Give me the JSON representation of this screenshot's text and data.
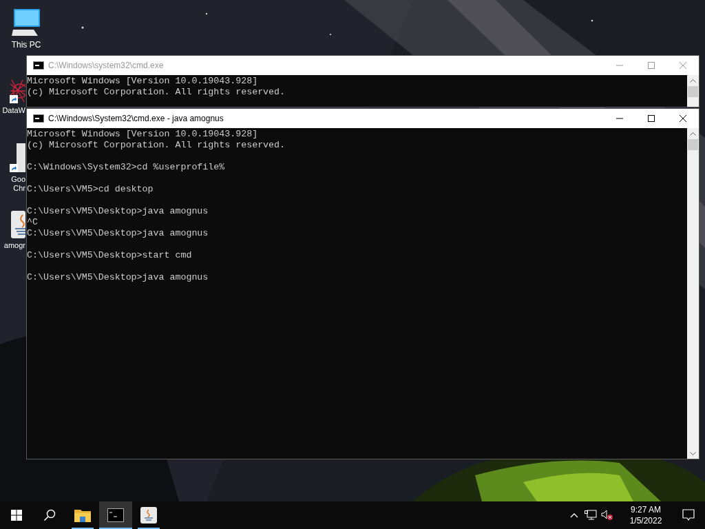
{
  "desktop_icons": [
    {
      "kind": "pc",
      "label_lines": [
        "This PC"
      ],
      "shortcut": false
    },
    {
      "kind": "web",
      "label_lines": [
        "DataW"
      ],
      "shortcut": true
    },
    {
      "kind": "browser",
      "label_lines": [
        "Goo",
        "Chr"
      ],
      "shortcut": true
    },
    {
      "kind": "java",
      "label_lines": [
        "amogr"
      ],
      "shortcut": false
    }
  ],
  "windows": [
    {
      "title": "C:\\Windows\\system32\\cmd.exe",
      "active": false,
      "blocks": [
        [
          "Microsoft Windows [Version 10.0.19043.928]",
          "(c) Microsoft Corporation. All rights reserved."
        ]
      ]
    },
    {
      "title": "C:\\Windows\\System32\\cmd.exe - java  amognus",
      "active": true,
      "blocks": [
        [
          "Microsoft Windows [Version 10.0.19043.928]",
          "(c) Microsoft Corporation. All rights reserved."
        ],
        [
          "C:\\Windows\\System32>cd %userprofile%"
        ],
        [
          "C:\\Users\\VM5>cd desktop"
        ],
        [
          "C:\\Users\\VM5\\Desktop>java amognus",
          "^C",
          "C:\\Users\\VM5\\Desktop>java amognus"
        ],
        [
          "C:\\Users\\VM5\\Desktop>start cmd"
        ],
        [
          "C:\\Users\\VM5\\Desktop>java amognus"
        ]
      ]
    }
  ],
  "taskbar": {
    "apps": [
      {
        "kind": "explorer",
        "selected": false
      },
      {
        "kind": "cmd",
        "selected": true
      },
      {
        "kind": "java",
        "selected": false
      }
    ],
    "time": "9:27 AM",
    "date": "1/5/2022"
  }
}
